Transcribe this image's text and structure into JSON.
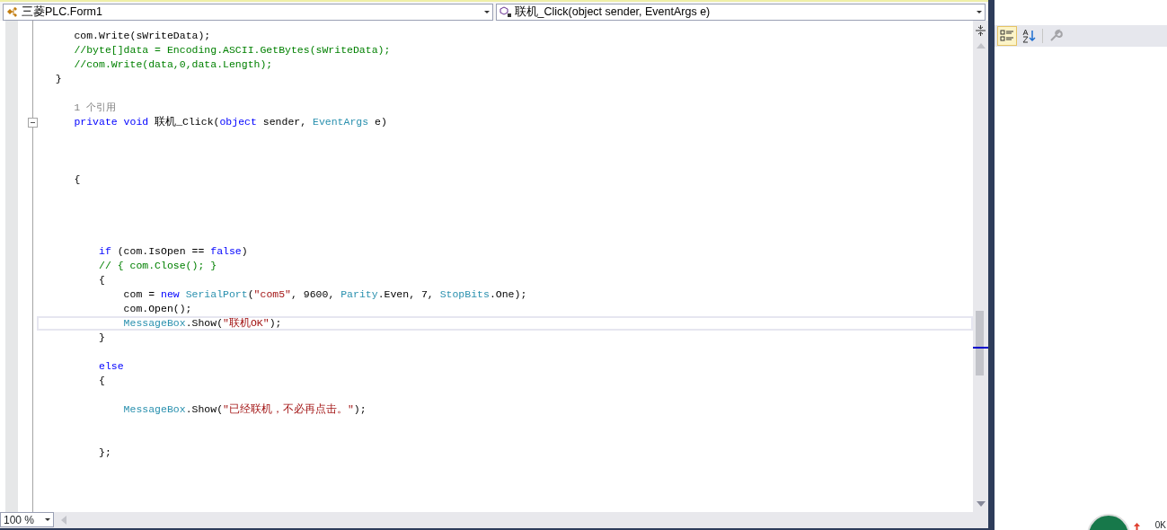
{
  "navigation_bar": {
    "type_dropdown": {
      "value": "三菱PLC.Form1"
    },
    "member_dropdown": {
      "value": "联机_Click(object sender, EventArgs e)"
    }
  },
  "code_lines": [
    {
      "kind": "code",
      "tokens": [
        {
          "kind": "plain",
          "text": "      com.Write(sWriteData);"
        }
      ]
    },
    {
      "kind": "code",
      "tokens": [
        {
          "kind": "comment",
          "text": "      //byte[]data = Encoding.ASCII.GetBytes(sWriteData);"
        }
      ]
    },
    {
      "kind": "code",
      "tokens": [
        {
          "kind": "comment",
          "text": "      //com.Write(data,0,data.Length);"
        }
      ]
    },
    {
      "kind": "code",
      "tokens": [
        {
          "kind": "plain",
          "text": "   }"
        }
      ]
    },
    {
      "kind": "blank"
    },
    {
      "kind": "code",
      "tokens": [
        {
          "kind": "lens",
          "text": "      1 个引用"
        }
      ]
    },
    {
      "kind": "code",
      "collapsible": true,
      "tokens": [
        {
          "kind": "keyword",
          "text": "      private void"
        },
        {
          "kind": "plain",
          "text": " 联机_Click("
        },
        {
          "kind": "keyword",
          "text": "object"
        },
        {
          "kind": "plain",
          "text": " sender, "
        },
        {
          "kind": "type",
          "text": "EventArgs"
        },
        {
          "kind": "plain",
          "text": " e)"
        }
      ]
    },
    {
      "kind": "blank"
    },
    {
      "kind": "blank"
    },
    {
      "kind": "blank"
    },
    {
      "kind": "code",
      "tokens": [
        {
          "kind": "plain",
          "text": "      {"
        }
      ]
    },
    {
      "kind": "blank"
    },
    {
      "kind": "blank"
    },
    {
      "kind": "blank"
    },
    {
      "kind": "blank"
    },
    {
      "kind": "code",
      "tokens": [
        {
          "kind": "keyword",
          "text": "          if"
        },
        {
          "kind": "plain",
          "text": " (com.IsOpen == "
        },
        {
          "kind": "keyword",
          "text": "false"
        },
        {
          "kind": "plain",
          "text": ")"
        }
      ]
    },
    {
      "kind": "code",
      "tokens": [
        {
          "kind": "comment",
          "text": "          // { com.Close(); }"
        }
      ]
    },
    {
      "kind": "code",
      "tokens": [
        {
          "kind": "plain",
          "text": "          {"
        }
      ]
    },
    {
      "kind": "code",
      "tokens": [
        {
          "kind": "plain",
          "text": "              com = "
        },
        {
          "kind": "keyword",
          "text": "new"
        },
        {
          "kind": "type",
          "text": " SerialPort"
        },
        {
          "kind": "plain",
          "text": "("
        },
        {
          "kind": "string",
          "text": "\"com5\""
        },
        {
          "kind": "plain",
          "text": ", 9600, "
        },
        {
          "kind": "type",
          "text": "Parity"
        },
        {
          "kind": "plain",
          "text": ".Even, 7, "
        },
        {
          "kind": "type",
          "text": "StopBits"
        },
        {
          "kind": "plain",
          "text": ".One);"
        }
      ]
    },
    {
      "kind": "code",
      "tokens": [
        {
          "kind": "plain",
          "text": "              com.Open();"
        }
      ]
    },
    {
      "kind": "code",
      "current": true,
      "tokens": [
        {
          "kind": "type",
          "text": "              MessageBox"
        },
        {
          "kind": "plain",
          "text": ".Show("
        },
        {
          "kind": "string",
          "text": "\"联机OK\""
        },
        {
          "kind": "plain",
          "text": ");"
        }
      ]
    },
    {
      "kind": "code",
      "tokens": [
        {
          "kind": "plain",
          "text": "          }"
        }
      ]
    },
    {
      "kind": "blank"
    },
    {
      "kind": "code",
      "tokens": [
        {
          "kind": "keyword",
          "text": "          else"
        }
      ]
    },
    {
      "kind": "code",
      "tokens": [
        {
          "kind": "plain",
          "text": "          {"
        }
      ]
    },
    {
      "kind": "blank"
    },
    {
      "kind": "code",
      "tokens": [
        {
          "kind": "type",
          "text": "              MessageBox"
        },
        {
          "kind": "plain",
          "text": ".Show("
        },
        {
          "kind": "string",
          "text": "\"已经联机，不必再点击。\""
        },
        {
          "kind": "plain",
          "text": ");"
        }
      ]
    },
    {
      "kind": "blank"
    },
    {
      "kind": "blank"
    },
    {
      "kind": "code",
      "tokens": [
        {
          "kind": "plain",
          "text": "          };"
        }
      ]
    }
  ],
  "zoom": {
    "value": "100 %"
  },
  "properties_toolbar": {
    "buttons": [
      {
        "kind": "categorized",
        "selected": true,
        "disabled": false
      },
      {
        "kind": "alphabetical",
        "selected": false,
        "disabled": false
      },
      {
        "kind": "property-pages",
        "selected": false,
        "disabled": true
      }
    ]
  },
  "tray": {
    "speed": "0K"
  }
}
